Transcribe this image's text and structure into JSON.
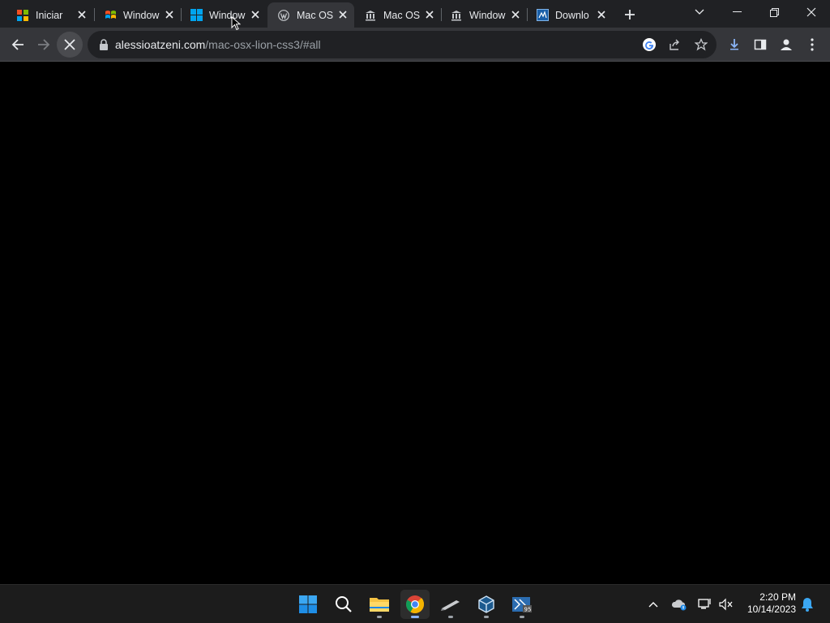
{
  "browser": {
    "tabs": [
      {
        "title": "Iniciar",
        "icon": "windows-logo-icon"
      },
      {
        "title": "Window",
        "icon": "windows-xp-logo-icon"
      },
      {
        "title": "Window",
        "icon": "windows-11-logo-icon"
      },
      {
        "title": "Mac OS",
        "icon": "wordpress-icon",
        "active": true
      },
      {
        "title": "Mac OS",
        "icon": "archive-building-icon"
      },
      {
        "title": "Window",
        "icon": "archive-building-icon"
      },
      {
        "title": "Downlo",
        "icon": "download-site-icon"
      }
    ],
    "url": {
      "domain": "alessioatzeni.com",
      "path": "/mac-osx-lion-css3/#all"
    }
  },
  "taskbar": {
    "time": "2:20 PM",
    "date": "10/14/2023"
  },
  "colors": {
    "tabstrip": "#202124",
    "toolbar": "#35363a",
    "taskbar": "#1c1c1c",
    "accent_blue": "#8ab4f8"
  }
}
